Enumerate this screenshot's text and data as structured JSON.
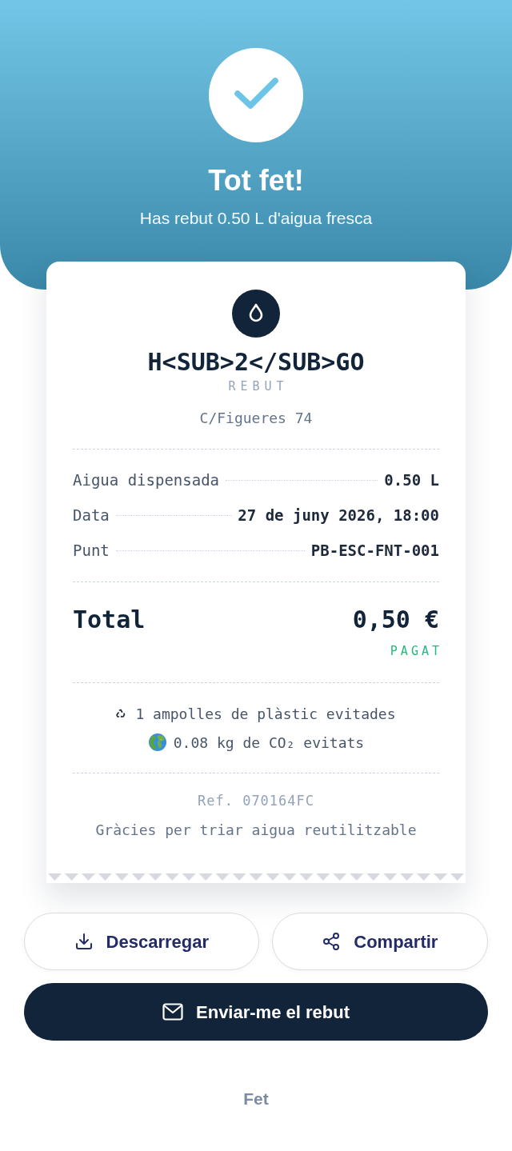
{
  "header": {
    "title": "Tot fet!",
    "subtitle": "Has rebut 0.50 L d'aigua fresca"
  },
  "receipt": {
    "brand": "H<SUB>2</SUB>GO",
    "label": "REBUT",
    "address": "C/Figueres 74",
    "lines": [
      {
        "label": "Aigua dispensada",
        "value": "0.50 L"
      },
      {
        "label": "Data",
        "value": "27 de juny 2026, 18:00"
      },
      {
        "label": "Punt",
        "value": "PB-ESC-FNT-001"
      }
    ],
    "total": {
      "label": "Total",
      "value": "0,50 €",
      "status": "PAGAT"
    },
    "impact": [
      {
        "kind": "recycle",
        "text": "1 ampolles de plàstic evitades"
      },
      {
        "kind": "globe",
        "text": "0.08 kg de CO₂ evitats"
      }
    ],
    "reference": "Ref. 070164FC",
    "thanks": "Gràcies per triar aigua reutilitzable"
  },
  "actions": [
    {
      "kind": "download",
      "label": "Descarregar"
    },
    {
      "kind": "share",
      "label": "Compartir"
    }
  ],
  "primary_action": {
    "kind": "mail",
    "label": "Enviar-me el rebut"
  },
  "done": {
    "label": "Fet"
  }
}
